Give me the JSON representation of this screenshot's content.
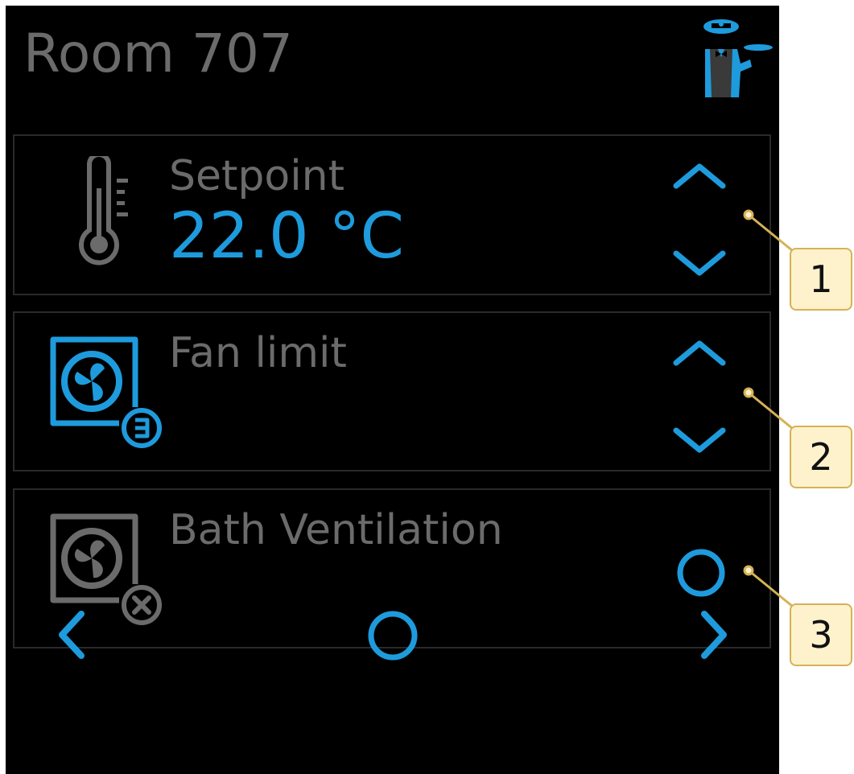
{
  "header": {
    "title": "Room 707",
    "logo_icon": "butler-waiter-icon"
  },
  "panels": [
    {
      "label": "Setpoint",
      "value": "22.0 °C",
      "icon": "thermometer-icon",
      "controls": [
        "chevron-up-icon",
        "chevron-down-icon"
      ]
    },
    {
      "label": "Fan limit",
      "value": "",
      "icon": "fan-level-3-icon",
      "controls": [
        "chevron-up-icon",
        "chevron-down-icon"
      ]
    },
    {
      "label": "Bath Ventilation",
      "value": "",
      "icon": "fan-off-icon",
      "controls": [
        "circle-toggle-icon"
      ]
    }
  ],
  "footer": {
    "controls": [
      "chevron-left-icon",
      "circle-home-icon",
      "chevron-right-icon"
    ]
  },
  "callouts": [
    "1",
    "2",
    "3"
  ],
  "colors": {
    "background": "#000000",
    "accent": "#1e9bdc",
    "text_muted": "#6b6b6b",
    "panel_border": "#2a2a2a",
    "callout_fill": "#fdf2cc",
    "callout_border": "#d6b256"
  }
}
